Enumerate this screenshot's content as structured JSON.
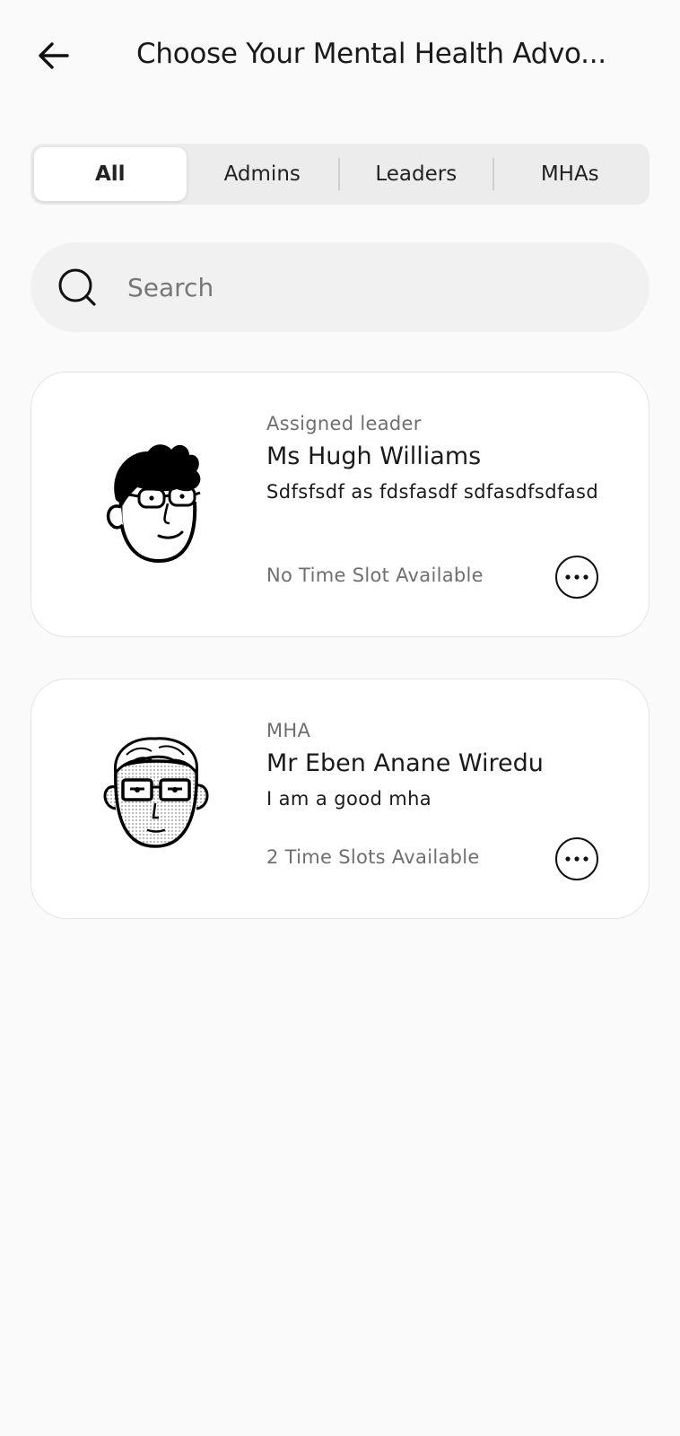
{
  "header": {
    "back_icon": "arrow-left-icon",
    "title": "Choose Your Mental Health Advo..."
  },
  "tabs": [
    {
      "label": "All",
      "active": true
    },
    {
      "label": "Admins",
      "active": false
    },
    {
      "label": "Leaders",
      "active": false
    },
    {
      "label": "MHAs",
      "active": false
    }
  ],
  "search": {
    "icon": "search-icon",
    "placeholder": "Search",
    "value": ""
  },
  "advocates": [
    {
      "role": "Assigned leader",
      "name": "Ms Hugh Williams",
      "bio": "Sdfsfsdf as fdsfasdf sdfasdfsdfasd",
      "availability": "No Time Slot Available",
      "avatar": "avatar-illustration-messy-hair-glasses",
      "more_icon": "more-horizontal-icon"
    },
    {
      "role": "MHA",
      "name": "Mr Eben Anane Wiredu",
      "bio": "I am a good mha",
      "availability": "2 Time Slots Available",
      "avatar": "avatar-illustration-grey-hair-glasses",
      "more_icon": "more-horizontal-icon"
    }
  ],
  "colors": {
    "background": "#fafafa",
    "card": "#ffffff",
    "secondary_text": "#6f6f6f",
    "segment_bg": "#ececec"
  }
}
